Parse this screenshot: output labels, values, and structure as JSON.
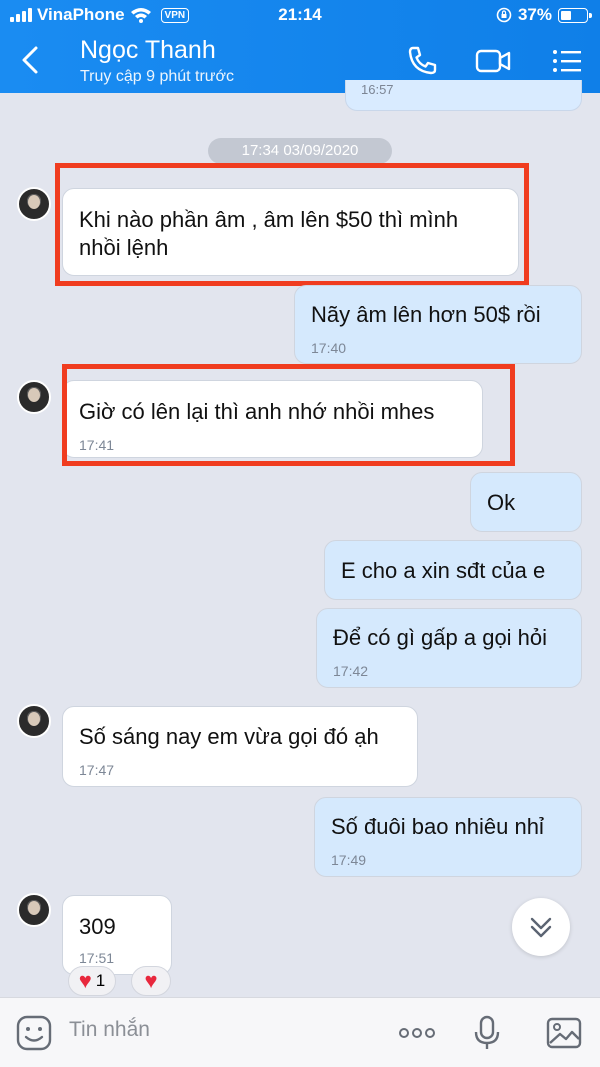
{
  "status_bar": {
    "carrier": "VinaPhone",
    "vpn": "VPN",
    "time": "21:14",
    "battery": "37%"
  },
  "header": {
    "contact_name": "Ngọc Thanh",
    "last_seen": "Truy cập 9 phút trước"
  },
  "chat": {
    "previous_time": "16:57",
    "date_separator": "17:34 03/09/2020",
    "messages": [
      {
        "lines": [
          "Khi nào phần âm , âm lên $50 thì mình",
          "nhồi lệnh"
        ],
        "time": ""
      },
      {
        "lines": [
          "Nãy âm lên hơn 50$ rồi"
        ],
        "time": "17:40"
      },
      {
        "lines": [
          "Giờ có lên lại thì anh nhớ nhồi mhes"
        ],
        "time": "17:41"
      },
      {
        "lines": [
          "Ok"
        ],
        "time": ""
      },
      {
        "lines": [
          "E cho a xin sđt của e"
        ],
        "time": ""
      },
      {
        "lines": [
          "Để có gì gấp a gọi hỏi"
        ],
        "time": "17:42"
      },
      {
        "lines": [
          "Số sáng nay em vừa gọi đó ạh"
        ],
        "time": "17:47"
      },
      {
        "lines": [
          "Số đuôi bao nhiêu nhỉ"
        ],
        "time": "17:49"
      },
      {
        "lines": [
          "309"
        ],
        "time": "17:51"
      }
    ],
    "reaction": {
      "count": "1"
    }
  },
  "input": {
    "placeholder": "Tin nhắn"
  },
  "colors": {
    "header": "#1a8cf2",
    "outgoing": "#d5e9fd",
    "incoming": "#ffffff",
    "highlight": "#f03c1f",
    "heart": "#e8283d"
  }
}
